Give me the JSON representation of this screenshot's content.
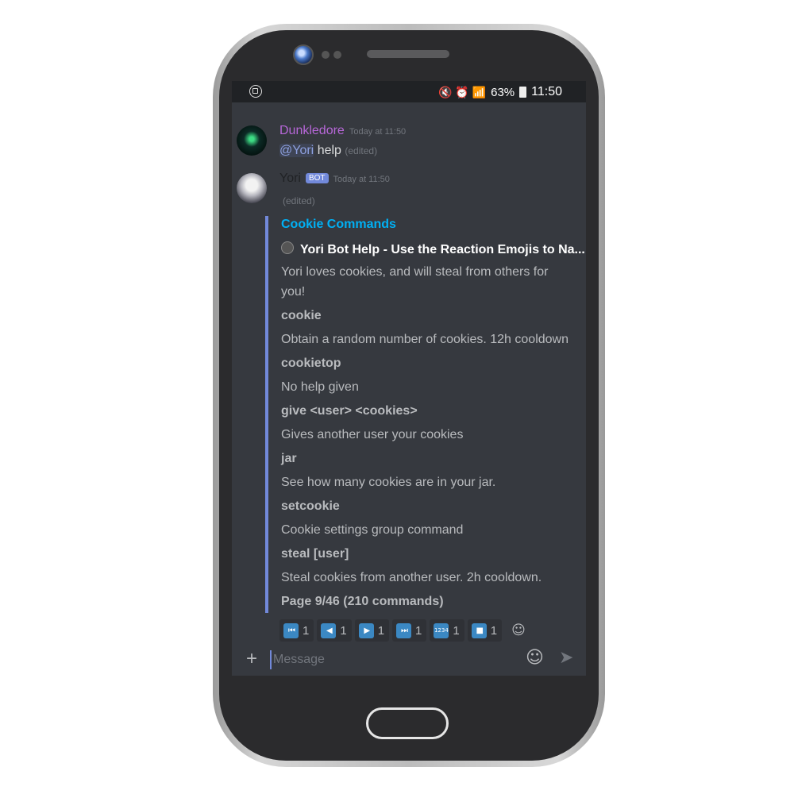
{
  "statusbar": {
    "icons": "🔇 ⏰ 📶",
    "battery": "63%",
    "time": "11:50"
  },
  "messages": [
    {
      "author": "Dunkledore",
      "author_color": "#b767d8",
      "timestamp": "Today at 11:50",
      "mention": "@Yori",
      "text": "help",
      "edited": "(edited)"
    },
    {
      "author": "Yori",
      "badge": "BOT",
      "timestamp": "Today at 11:50",
      "edited": "(edited)"
    }
  ],
  "embed": {
    "accent": "#7289da",
    "title": "Cookie Commands",
    "author": "Yori Bot Help - Use the Reaction Emojis to Na...",
    "description_1": "Yori loves cookies, and will steal from others for",
    "description_2": "you!",
    "fields": [
      {
        "name": "cookie",
        "value": "Obtain a random number of cookies. 12h cooldown"
      },
      {
        "name": "cookietop",
        "value": "No help given"
      },
      {
        "name": "give <user> <cookies>",
        "value": "Gives another user your cookies"
      },
      {
        "name": "jar",
        "value": "See how many cookies are in your jar."
      },
      {
        "name": "setcookie",
        "value": "Cookie settings group command"
      },
      {
        "name": "steal [user]",
        "value": "Steal cookies from another user. 2h cooldown."
      }
    ],
    "footer": "Page 9/46 (210 commands)"
  },
  "reactions": [
    {
      "icon": "first-icon",
      "glyph": "⏮",
      "count": "1"
    },
    {
      "icon": "prev-icon",
      "glyph": "◀",
      "count": "1"
    },
    {
      "icon": "next-icon",
      "glyph": "▶",
      "count": "1"
    },
    {
      "icon": "last-icon",
      "glyph": "⏭",
      "count": "1"
    },
    {
      "icon": "numbers-icon",
      "glyph": "1234",
      "count": "1"
    },
    {
      "icon": "stop-icon",
      "glyph": "■",
      "count": "1"
    }
  ],
  "composer": {
    "placeholder": "Message"
  }
}
